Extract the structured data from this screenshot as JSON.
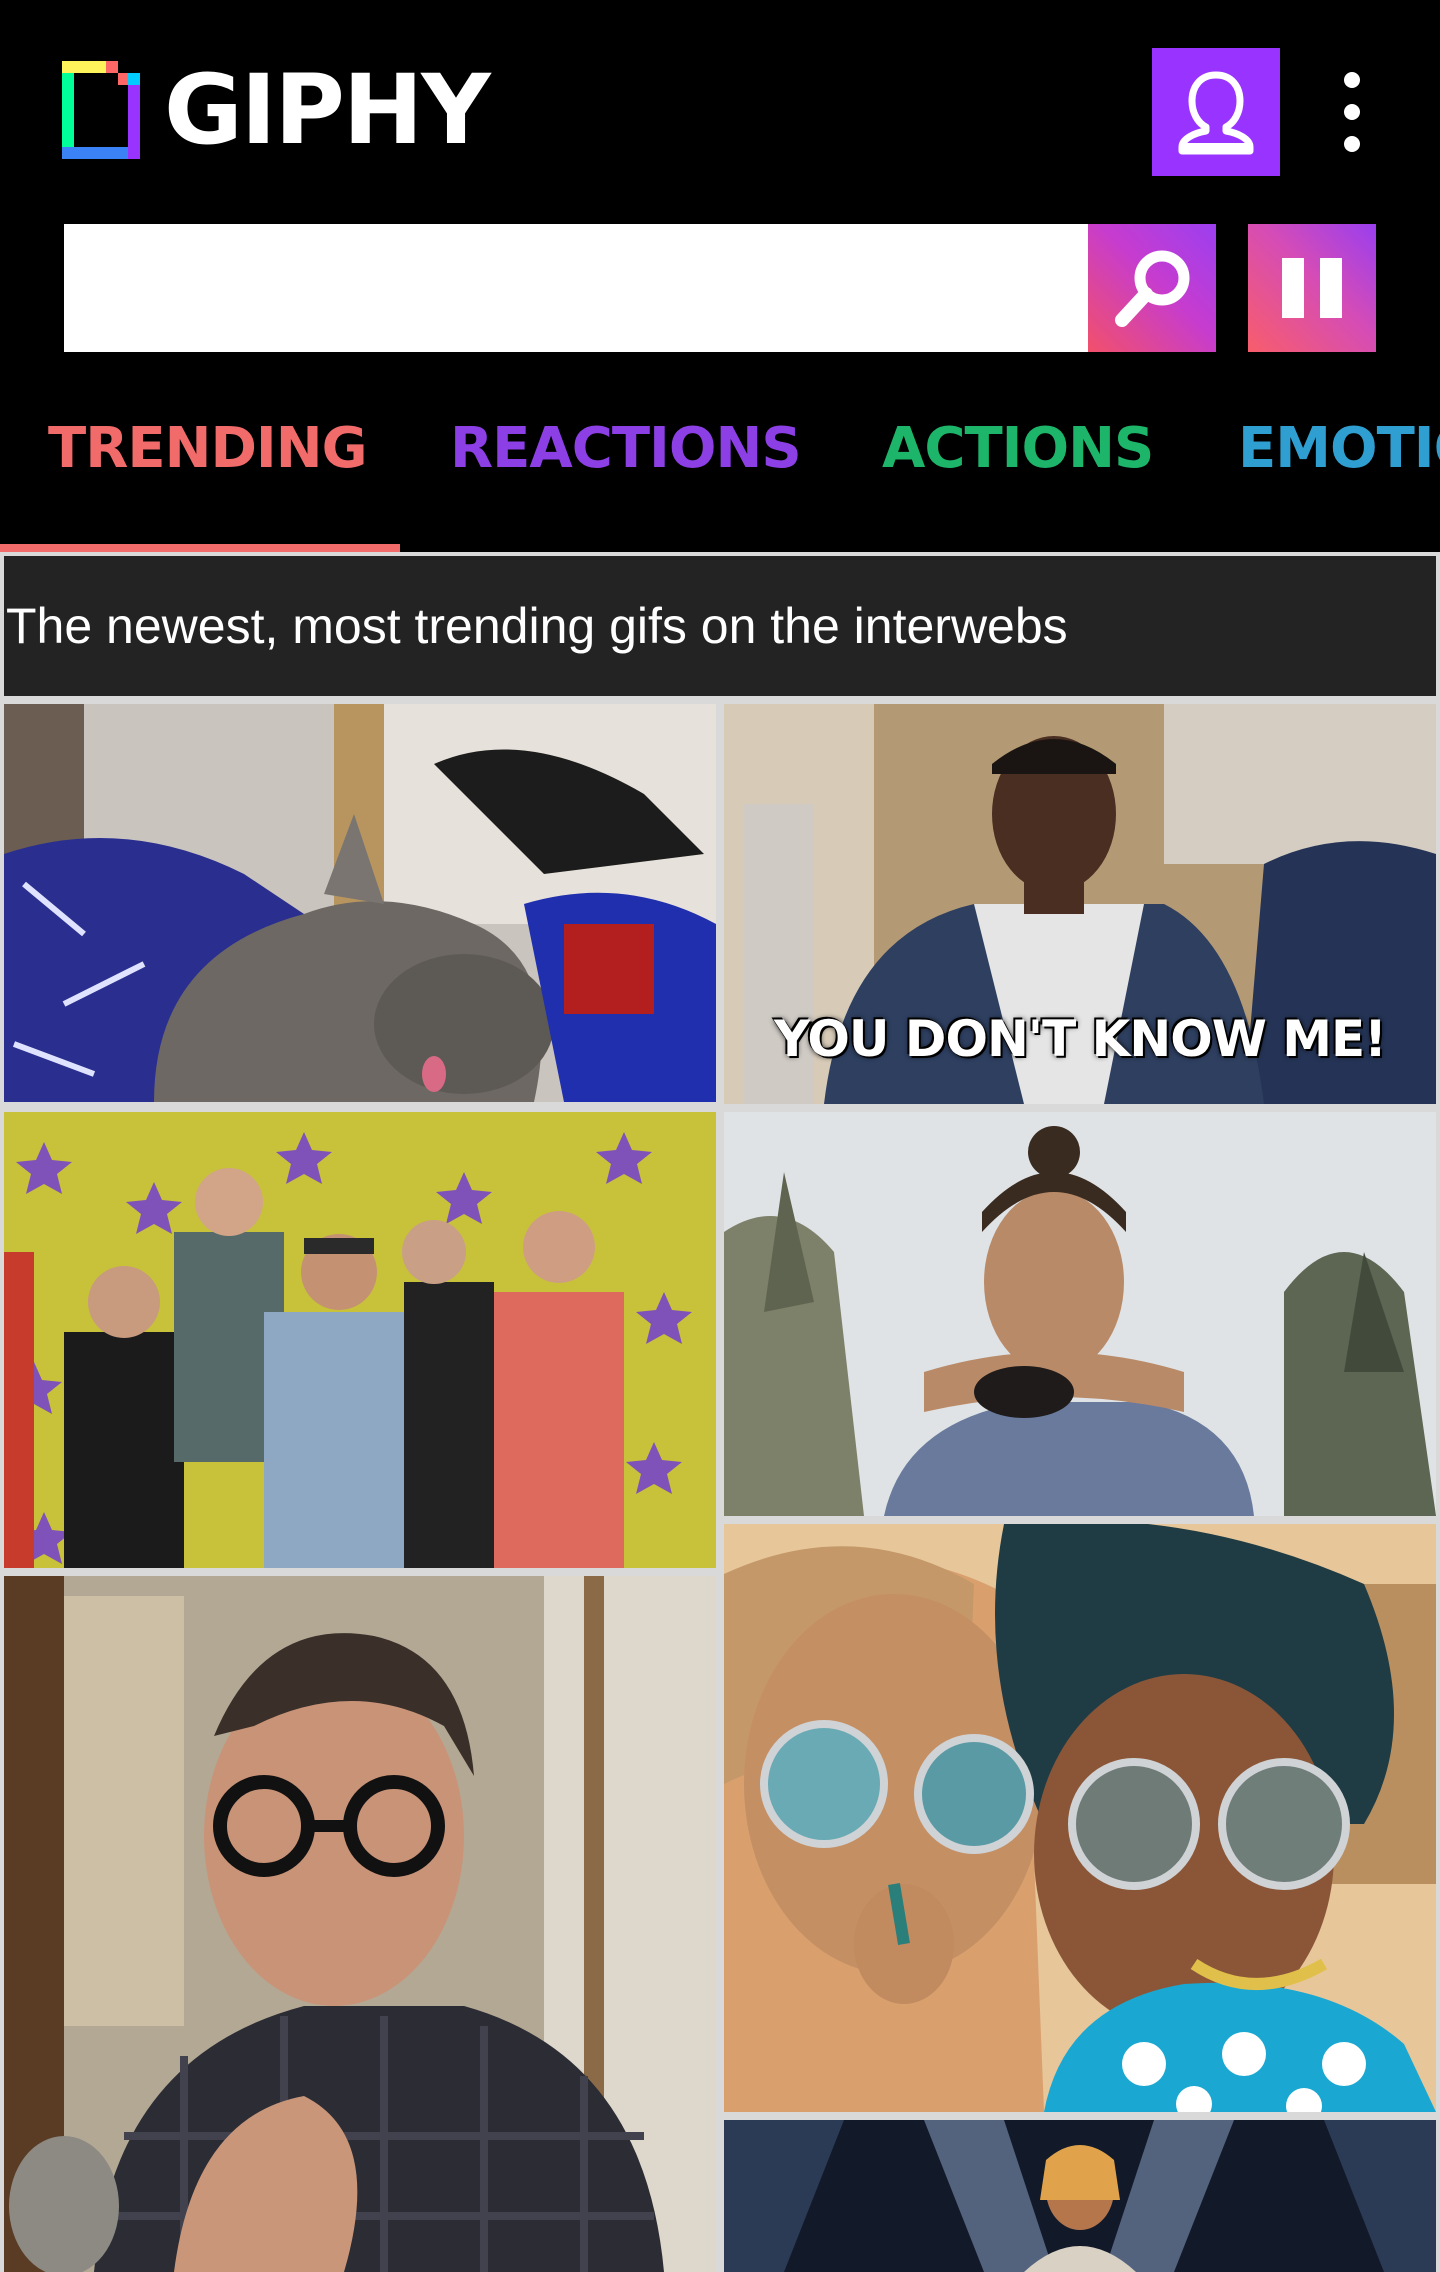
{
  "app": {
    "brand": "GIPHY",
    "colors": {
      "accent_purple": "#9933ff",
      "trending": "#f26b6b",
      "reactions": "#8d3fe6",
      "actions": "#1db56a",
      "emotions": "#2f9fd1"
    }
  },
  "header": {
    "avatar_icon": "user-avatar-icon",
    "menu_icon": "more-vertical-icon"
  },
  "search": {
    "value": "",
    "placeholder": "",
    "search_icon": "search-icon",
    "pause_icon": "pause-icon"
  },
  "tabs": [
    {
      "label": "TRENDING",
      "active": true
    },
    {
      "label": "REACTIONS",
      "active": false
    },
    {
      "label": "ACTIONS",
      "active": false
    },
    {
      "label": "EMOTIO",
      "active": false
    }
  ],
  "banner": {
    "text": "The newest, most trending gifs on the interwebs"
  },
  "gifs": [
    {
      "subject": "cat",
      "caption": ""
    },
    {
      "subject": "man",
      "caption": "YOU DON'T KNOW ME!"
    },
    {
      "subject": "group",
      "caption": ""
    },
    {
      "subject": "woman",
      "caption": ""
    },
    {
      "subject": "man-glasses",
      "caption": ""
    },
    {
      "subject": "two-girls-sunglasses",
      "caption": ""
    },
    {
      "subject": "stage",
      "caption": ""
    }
  ]
}
